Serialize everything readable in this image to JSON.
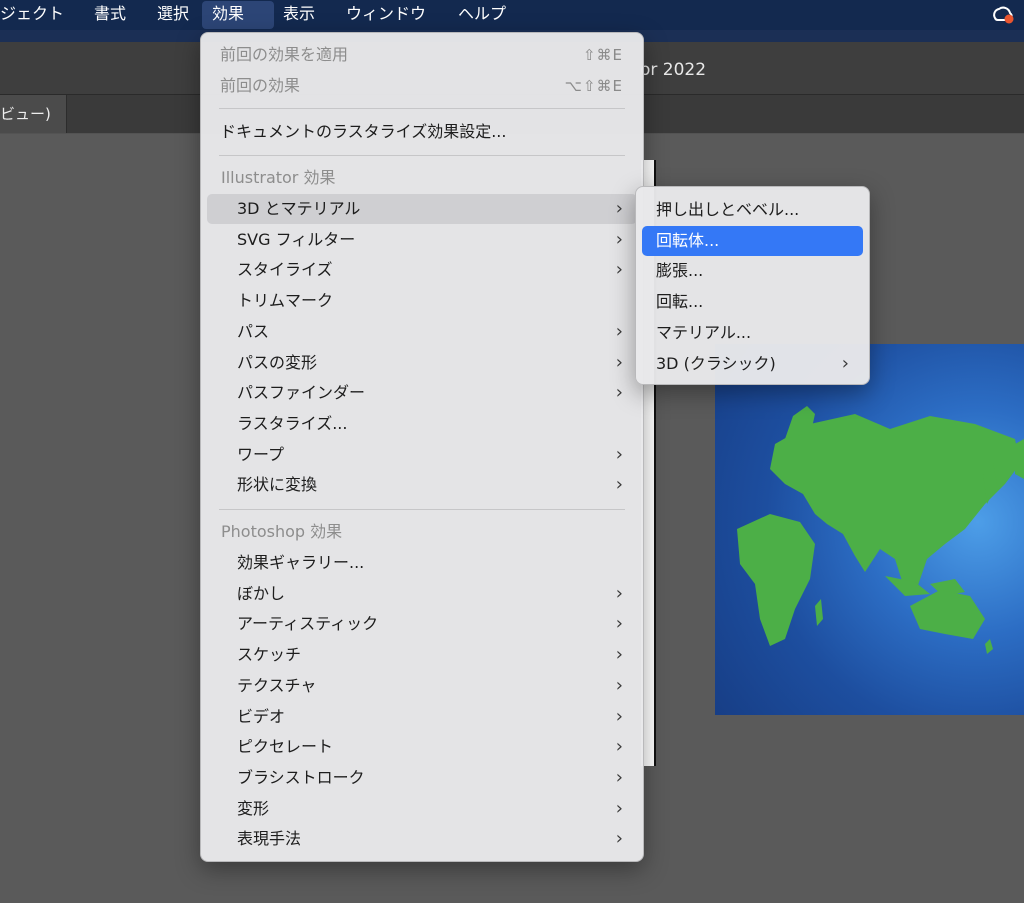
{
  "menubar": {
    "items": [
      "ジェクト",
      "書式",
      "選択",
      "効果",
      "表示",
      "ウィンドウ",
      "ヘルプ"
    ],
    "active_index": 3
  },
  "window": {
    "title_fragment": "or 2022",
    "tab_label": "ビュー)"
  },
  "effect_menu": {
    "top": [
      {
        "label": "前回の効果を適用",
        "shortcut": "⇧⌘E",
        "disabled": true
      },
      {
        "label": "前回の効果",
        "shortcut": "⌥⇧⌘E",
        "disabled": true
      },
      {
        "label": "ドキュメントのラスタライズ効果設定...",
        "shortcut": "",
        "disabled": false
      }
    ],
    "illustrator_section": "Illustrator 効果",
    "illustrator_items": [
      {
        "label": "3D とマテリアル",
        "submenu": true
      },
      {
        "label": "SVG フィルター",
        "submenu": true
      },
      {
        "label": "スタイライズ",
        "submenu": true
      },
      {
        "label": "トリムマーク",
        "submenu": false
      },
      {
        "label": "パス",
        "submenu": true
      },
      {
        "label": "パスの変形",
        "submenu": true
      },
      {
        "label": "パスファインダー",
        "submenu": true
      },
      {
        "label": "ラスタライズ...",
        "submenu": false
      },
      {
        "label": "ワープ",
        "submenu": true
      },
      {
        "label": "形状に変換",
        "submenu": true
      }
    ],
    "photoshop_section": "Photoshop 効果",
    "photoshop_items": [
      {
        "label": "効果ギャラリー...",
        "submenu": false
      },
      {
        "label": "ぼかし",
        "submenu": true
      },
      {
        "label": "アーティスティック",
        "submenu": true
      },
      {
        "label": "スケッチ",
        "submenu": true
      },
      {
        "label": "テクスチャ",
        "submenu": true
      },
      {
        "label": "ビデオ",
        "submenu": true
      },
      {
        "label": "ピクセレート",
        "submenu": true
      },
      {
        "label": "ブラシストローク",
        "submenu": true
      },
      {
        "label": "変形",
        "submenu": true
      },
      {
        "label": "表現手法",
        "submenu": true
      }
    ],
    "chevron": "›"
  },
  "submenu_3d": {
    "items": [
      {
        "label": "押し出しとベベル...",
        "submenu": false
      },
      {
        "label": "回転体...",
        "submenu": false,
        "selected": true
      },
      {
        "label": "膨張...",
        "submenu": false
      },
      {
        "label": "回転...",
        "submenu": false
      },
      {
        "label": "マテリアル...",
        "submenu": false
      },
      {
        "label": "3D (クラシック)",
        "submenu": true
      }
    ]
  },
  "colors": {
    "menubar_bg": "#13294f",
    "selection": "#3478f6",
    "land": "#4caf47",
    "ocean": "#1d4e9f"
  }
}
